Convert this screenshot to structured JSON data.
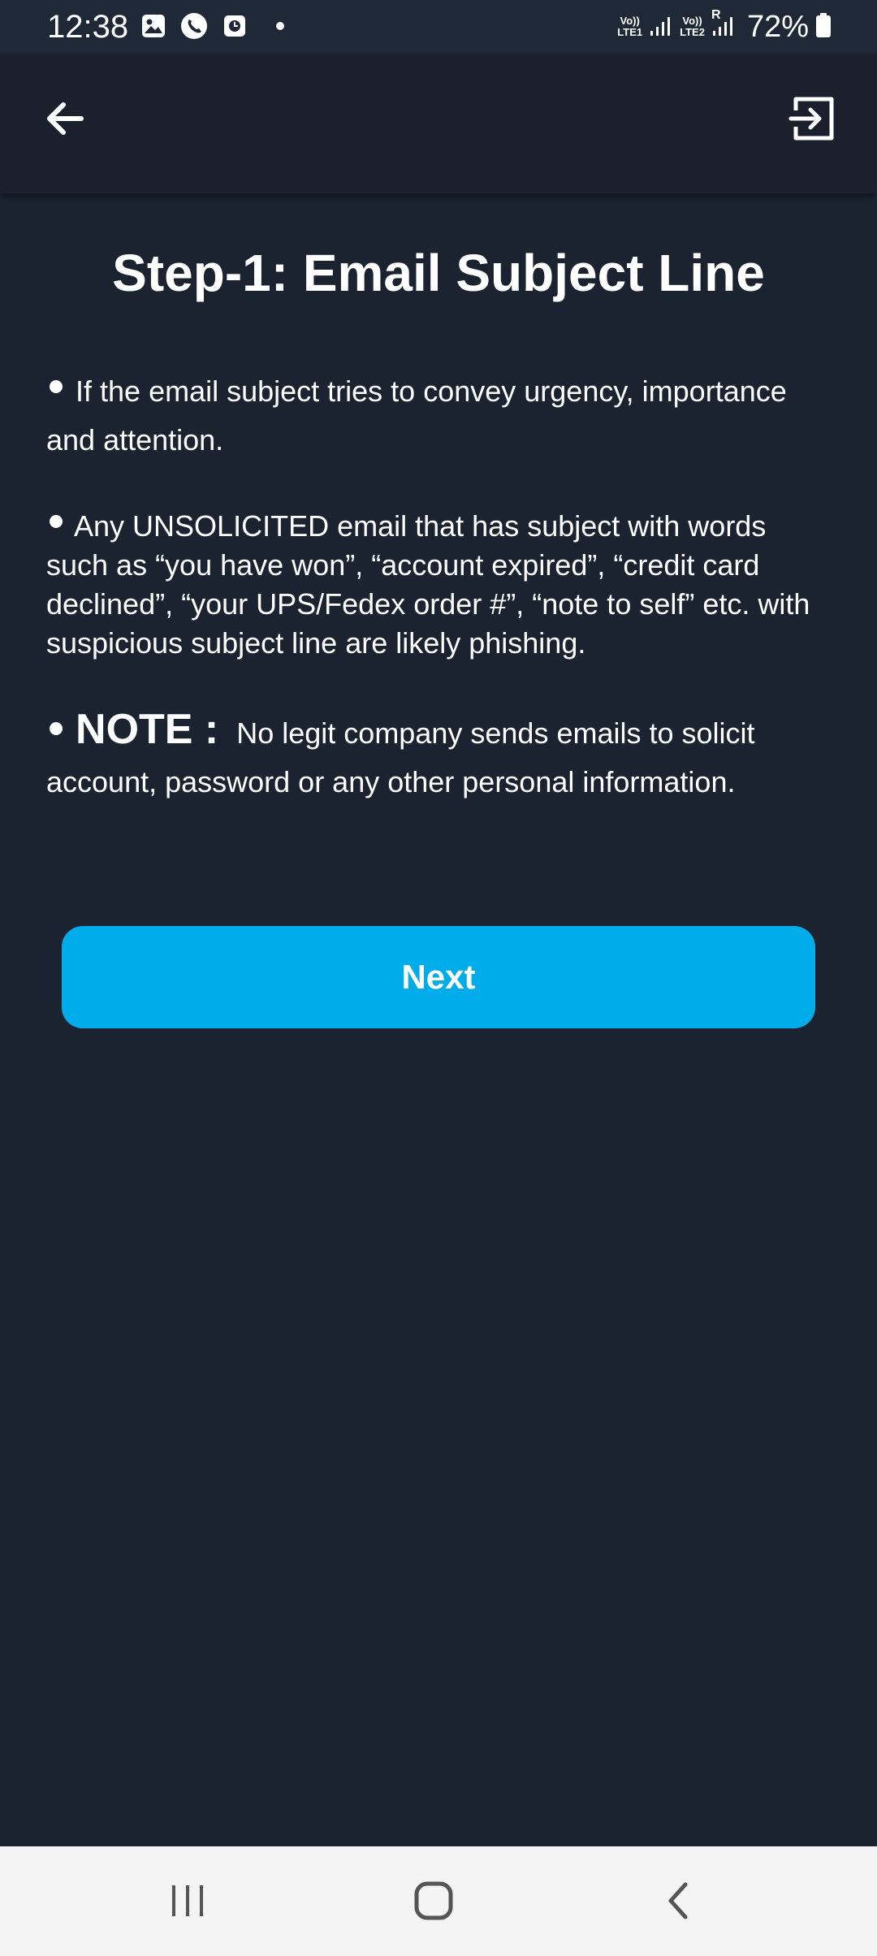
{
  "status_bar": {
    "time": "12:38",
    "icons_left": [
      "gallery-icon",
      "phone-call-icon",
      "screen-recorder-icon",
      "notification-dot"
    ],
    "sim1_label": [
      "Vo))",
      "LTE1"
    ],
    "sim2_label": [
      "Vo))",
      "LTE2"
    ],
    "roaming_label": "R",
    "battery": "72%"
  },
  "app_bar": {
    "back_icon": "arrow-left-icon",
    "exit_icon": "exit-icon"
  },
  "content": {
    "title": "Step-1: Email Subject Line",
    "bullet1": "If the email subject tries to convey urgency, importance and attention.",
    "bullet2": "Any UNSOLICITED email that has subject with words such as “you have won”, “account expired”, “credit card declined”, “your UPS/Fedex order #”, “note to self” etc. with suspicious subject line are likely phishing.",
    "note_label": "NOTE :",
    "note_text": "No legit company sends emails to solicit account, password or any other personal information."
  },
  "next_button": {
    "label": "Next",
    "color": "#00adea"
  },
  "nav_bar": {
    "recents_icon": "recents-icon",
    "home_icon": "home-icon",
    "back_icon": "back-chevron-icon"
  },
  "colors": {
    "background": "#1b2330",
    "accent": "#00adea"
  }
}
